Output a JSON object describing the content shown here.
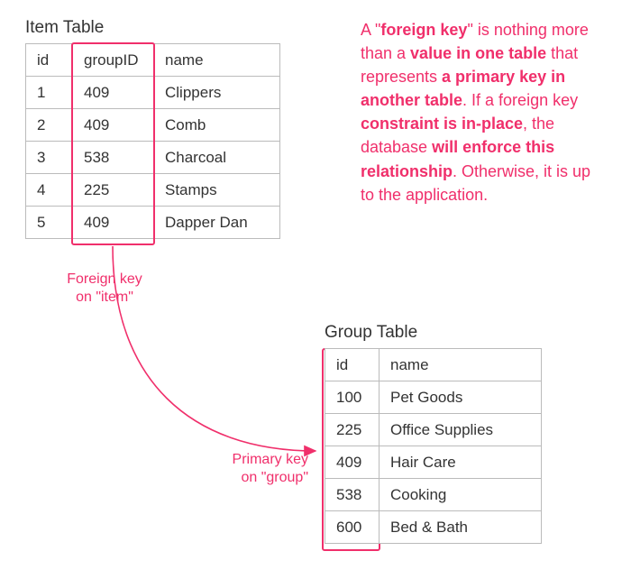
{
  "itemTable": {
    "title": "Item Table",
    "headers": {
      "id": "id",
      "groupID": "groupID",
      "name": "name"
    },
    "rows": [
      {
        "id": "1",
        "groupID": "409",
        "name": "Clippers"
      },
      {
        "id": "2",
        "groupID": "409",
        "name": "Comb"
      },
      {
        "id": "3",
        "groupID": "538",
        "name": "Charcoal"
      },
      {
        "id": "4",
        "groupID": "225",
        "name": "Stamps"
      },
      {
        "id": "5",
        "groupID": "409",
        "name": "Dapper Dan"
      }
    ]
  },
  "groupTable": {
    "title": "Group Table",
    "headers": {
      "id": "id",
      "name": "name"
    },
    "rows": [
      {
        "id": "100",
        "name": "Pet Goods"
      },
      {
        "id": "225",
        "name": "Office Supplies"
      },
      {
        "id": "409",
        "name": "Hair Care"
      },
      {
        "id": "538",
        "name": "Cooking"
      },
      {
        "id": "600",
        "name": "Bed & Bath"
      }
    ]
  },
  "note": {
    "t1": "A \"",
    "b1": "foreign key",
    "t2": "\" is nothing more than a ",
    "b2": "value in one table",
    "t3": " that represents ",
    "b3": "a primary key in another table",
    "t4": ". If a foreign key ",
    "b4": "constraint is in-place",
    "t5": ", the database ",
    "b5": "will enforce this relationship",
    "t6": ". Otherwise, it is up to the application."
  },
  "labels": {
    "fk1": "Foreign key",
    "fk2": "on \"item\"",
    "pk1": "Primary key",
    "pk2": "on \"group\""
  },
  "accent": "#f02f6b"
}
